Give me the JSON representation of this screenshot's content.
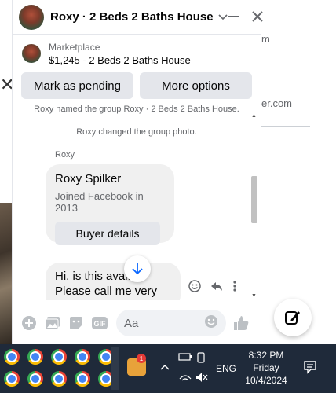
{
  "background": {
    "right_text_1": "m",
    "right_text_2": "er.com"
  },
  "chat": {
    "title": "Roxy · 2 Beds 2 Baths House",
    "marketplace": {
      "label": "Marketplace",
      "listing": "$1,245 - 2 Beds 2 Baths House"
    },
    "actions": {
      "mark_pending": "Mark as pending",
      "more_options": "More options"
    },
    "system_messages": [
      "Roxy named the group Roxy · 2 Beds 2 Baths House.",
      "Roxy changed the group photo."
    ],
    "sender": "Roxy",
    "profile_card": {
      "name": "Roxy Spilker",
      "joined": "Joined Facebook in 2013",
      "button": "Buyer details"
    },
    "message": "Hi, is this avai... Please call me very",
    "composer_placeholder": "Aa"
  },
  "taskbar": {
    "badge_count": "1",
    "language": "ENG",
    "time": "8:32 PM",
    "day": "Friday",
    "date": "10/4/2024"
  },
  "colors": {
    "accent": "#0866ff",
    "taskbar": "#1f2a3a"
  }
}
